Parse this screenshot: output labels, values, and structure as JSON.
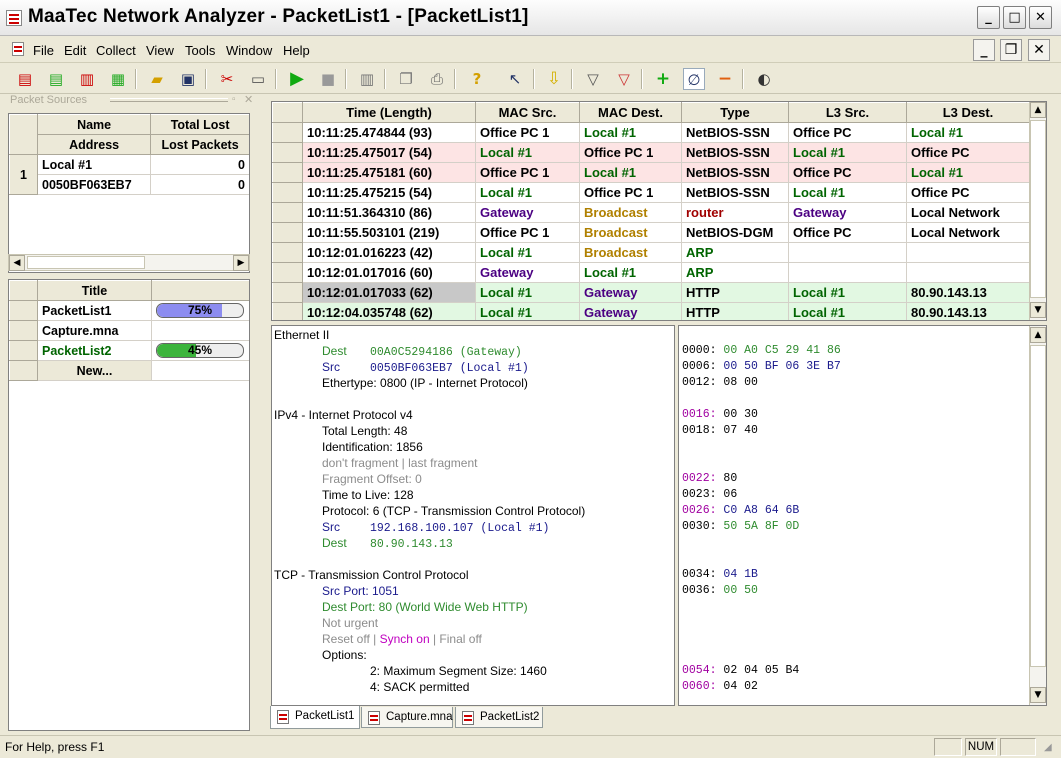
{
  "window": {
    "title": "MaaTec Network Analyzer - PacketList1 - [PacketList1]"
  },
  "menu": [
    "File",
    "Edit",
    "Collect",
    "View",
    "Tools",
    "Window",
    "Help"
  ],
  "sources": {
    "header": "Packet Sources",
    "columns": [
      [
        "Name",
        "Address"
      ],
      [
        "Total Lost",
        "Lost Packets"
      ]
    ],
    "rows": [
      {
        "num": "1",
        "name": "Local #1",
        "address": "0050BF063EB7",
        "total_lost": "0",
        "lost_packets": "0"
      }
    ]
  },
  "lists": {
    "header": "Title",
    "items": [
      {
        "title": "PacketList1",
        "percent": "75%",
        "fraction": 0.75,
        "color": "#8c8cf0"
      },
      {
        "title": "Capture.mna",
        "percent": "",
        "fraction": 0,
        "color": ""
      },
      {
        "title": "PacketList2",
        "percent": "45%",
        "fraction": 0.45,
        "color": "#3cb43c"
      }
    ],
    "new_label": "New..."
  },
  "packets": {
    "columns": [
      "Time  (Length)",
      "MAC Src.",
      "MAC Dest.",
      "Type",
      "L3 Src.",
      "L3 Dest."
    ],
    "rows": [
      {
        "time": "10:11:25.474844  (93)",
        "mac_src": "Office PC 1",
        "mac_dst": "Local #1",
        "type": "NetBIOS-SSN",
        "l3_src": "Office PC",
        "l3_dst": "Local #1",
        "bg": "#ffffff",
        "c": [
          "#000",
          "#000",
          "#006400",
          "#000",
          "#000",
          "#006400"
        ]
      },
      {
        "time": "10:11:25.475017  (54)",
        "mac_src": "Local #1",
        "mac_dst": "Office PC 1",
        "type": "NetBIOS-SSN",
        "l3_src": "Local #1",
        "l3_dst": "Office PC",
        "bg": "#fde4e4",
        "c": [
          "#000",
          "#006400",
          "#000",
          "#000",
          "#006400",
          "#000"
        ]
      },
      {
        "time": "10:11:25.475181  (60)",
        "mac_src": "Office PC 1",
        "mac_dst": "Local #1",
        "type": "NetBIOS-SSN",
        "l3_src": "Office PC",
        "l3_dst": "Local #1",
        "bg": "#fde4e4",
        "c": [
          "#000",
          "#000",
          "#006400",
          "#000",
          "#000",
          "#006400"
        ]
      },
      {
        "time": "10:11:25.475215  (54)",
        "mac_src": "Local #1",
        "mac_dst": "Office PC 1",
        "type": "NetBIOS-SSN",
        "l3_src": "Local #1",
        "l3_dst": "Office PC",
        "bg": "#ffffff",
        "c": [
          "#000",
          "#006400",
          "#000",
          "#000",
          "#006400",
          "#000"
        ]
      },
      {
        "time": "10:11:51.364310  (86)",
        "mac_src": "Gateway",
        "mac_dst": "Broadcast",
        "type": "router",
        "l3_src": "Gateway",
        "l3_dst": "Local Network",
        "bg": "#ffffff",
        "c": [
          "#000",
          "#4b0082",
          "#b08000",
          "#a00000",
          "#4b0082",
          "#000"
        ]
      },
      {
        "time": "10:11:55.503101  (219)",
        "mac_src": "Office PC 1",
        "mac_dst": "Broadcast",
        "type": "NetBIOS-DGM",
        "l3_src": "Office PC",
        "l3_dst": "Local Network",
        "bg": "#ffffff",
        "c": [
          "#000",
          "#000",
          "#b08000",
          "#000",
          "#000",
          "#000"
        ]
      },
      {
        "time": "10:12:01.016223  (42)",
        "mac_src": "Local #1",
        "mac_dst": "Broadcast",
        "type": "ARP",
        "l3_src": "",
        "l3_dst": "",
        "bg": "#ffffff",
        "c": [
          "#000",
          "#006400",
          "#b08000",
          "#006400",
          "#000",
          "#000"
        ]
      },
      {
        "time": "10:12:01.017016  (60)",
        "mac_src": "Gateway",
        "mac_dst": "Local #1",
        "type": "ARP",
        "l3_src": "",
        "l3_dst": "",
        "bg": "#ffffff",
        "c": [
          "#000",
          "#4b0082",
          "#006400",
          "#006400",
          "#000",
          "#000"
        ]
      },
      {
        "time": "10:12:01.017033  (62)",
        "mac_src": "Local #1",
        "mac_dst": "Gateway",
        "type": "HTTP",
        "l3_src": "Local #1",
        "l3_dst": "80.90.143.13",
        "bg": "#e2f8e2",
        "c": [
          "#000",
          "#006400",
          "#4b0082",
          "#000",
          "#006400",
          "#000"
        ],
        "selected": true
      },
      {
        "time": "10:12:04.035748  (62)",
        "mac_src": "Local #1",
        "mac_dst": "Gateway",
        "type": "HTTP",
        "l3_src": "Local #1",
        "l3_dst": "80.90.143.13",
        "bg": "#e2f8e2",
        "c": [
          "#000",
          "#006400",
          "#4b0082",
          "#000",
          "#006400",
          "#000"
        ]
      }
    ]
  },
  "detail": [
    {
      "t": "Ethernet II",
      "i": 0,
      "c": "#000"
    },
    {
      "t": "Dest",
      "v": "00A0C5294186  (Gateway)",
      "i": 1,
      "c": "#2e8b2e",
      "vc": "#2e8b2e"
    },
    {
      "t": "Src",
      "v": "0050BF063EB7  (Local #1)",
      "i": 1,
      "c": "#1a1a8c",
      "vc": "#1a1a8c"
    },
    {
      "t": "Ethertype:  0800  (IP - Internet Protocol)",
      "i": 1,
      "c": "#000"
    },
    {
      "t": "",
      "i": 0,
      "c": "#000"
    },
    {
      "t": "IPv4 - Internet Protocol v4",
      "i": 0,
      "c": "#000"
    },
    {
      "t": "Total Length:  48",
      "i": 1,
      "c": "#000"
    },
    {
      "t": "Identification:  1856",
      "i": 1,
      "c": "#000"
    },
    {
      "t": "don't fragment | last fragment",
      "i": 1,
      "c": "#8c8c8c"
    },
    {
      "t": "Fragment Offset:  0",
      "i": 1,
      "c": "#8c8c8c"
    },
    {
      "t": "Time to Live:  128",
      "i": 1,
      "c": "#000"
    },
    {
      "t": "Protocol:  6  (TCP - Transmission Control Protocol)",
      "i": 1,
      "c": "#000"
    },
    {
      "t": "Src",
      "v": "192.168.100.107  (Local #1)",
      "i": 1,
      "c": "#1a1a8c",
      "vc": "#1a1a8c"
    },
    {
      "t": "Dest",
      "v": "80.90.143.13",
      "i": 1,
      "c": "#2e8b2e",
      "vc": "#2e8b2e"
    },
    {
      "t": "",
      "i": 0,
      "c": "#000"
    },
    {
      "t": "TCP - Transmission Control Protocol",
      "i": 0,
      "c": "#000"
    },
    {
      "t": "Src Port:  1051",
      "i": 1,
      "c": "#1a1a8c"
    },
    {
      "t": "Dest Port:  80  (World Wide Web HTTP)",
      "i": 1,
      "c": "#2e8b2e"
    },
    {
      "t": "Not urgent",
      "i": 1,
      "c": "#8c8c8c"
    },
    {
      "t": "Reset off | ",
      "t2": "Synch on",
      "t3": " | Final off",
      "i": 1,
      "c": "#8c8c8c",
      "c2": "#c000c0"
    },
    {
      "t": "Options:",
      "i": 1,
      "c": "#000"
    },
    {
      "t": "2:  Maximum Segment Size:  1460",
      "i": 2,
      "c": "#000"
    },
    {
      "t": "4:  SACK permitted",
      "i": 2,
      "c": "#000"
    }
  ],
  "hex": [
    {
      "a": "0000:",
      "b": "00 A0 C5 29 41 86",
      "ac": "#000",
      "bc": "#2e8b2e"
    },
    {
      "a": "0006:",
      "b": "00 50 BF 06 3E B7",
      "ac": "#000",
      "bc": "#1a1a8c"
    },
    {
      "a": "0012:",
      "b": "08 00",
      "ac": "#000",
      "bc": "#000"
    },
    {
      "a": "",
      "b": "",
      "ac": "#000",
      "bc": "#000"
    },
    {
      "a": "0016:",
      "b": "00 30",
      "ac": "#a000a0",
      "bc": "#000"
    },
    {
      "a": "0018:",
      "b": "07 40",
      "ac": "#000",
      "bc": "#000"
    },
    {
      "a": "",
      "b": "",
      "ac": "#000",
      "bc": "#000"
    },
    {
      "a": "",
      "b": "",
      "ac": "#000",
      "bc": "#000"
    },
    {
      "a": "0022:",
      "b": "80",
      "ac": "#a000a0",
      "bc": "#000"
    },
    {
      "a": "0023:",
      "b": "06",
      "ac": "#000",
      "bc": "#000"
    },
    {
      "a": "0026:",
      "b": "C0 A8 64 6B",
      "ac": "#a000a0",
      "bc": "#1a1a8c"
    },
    {
      "a": "0030:",
      "b": "50 5A 8F 0D",
      "ac": "#000",
      "bc": "#2e8b2e"
    },
    {
      "a": "",
      "b": "",
      "ac": "#000",
      "bc": "#000"
    },
    {
      "a": "",
      "b": "",
      "ac": "#000",
      "bc": "#000"
    },
    {
      "a": "0034:",
      "b": "04 1B",
      "ac": "#000",
      "bc": "#1a1a8c"
    },
    {
      "a": "0036:",
      "b": "00 50",
      "ac": "#000",
      "bc": "#2e8b2e"
    },
    {
      "a": "",
      "b": "",
      "ac": "#000",
      "bc": "#000"
    },
    {
      "a": "",
      "b": "",
      "ac": "#000",
      "bc": "#000"
    },
    {
      "a": "",
      "b": "",
      "ac": "#000",
      "bc": "#000"
    },
    {
      "a": "",
      "b": "",
      "ac": "#000",
      "bc": "#000"
    },
    {
      "a": "0054:",
      "b": "02 04 05 B4",
      "ac": "#a000a0",
      "bc": "#000"
    },
    {
      "a": "0060:",
      "b": "04 02",
      "ac": "#a000a0",
      "bc": "#000"
    }
  ],
  "tabs": [
    {
      "label": "PacketList1",
      "active": true
    },
    {
      "label": "Capture.mna",
      "active": false
    },
    {
      "label": "PacketList2",
      "active": false
    }
  ],
  "status": {
    "text": "For Help, press F1",
    "num": "NUM"
  }
}
